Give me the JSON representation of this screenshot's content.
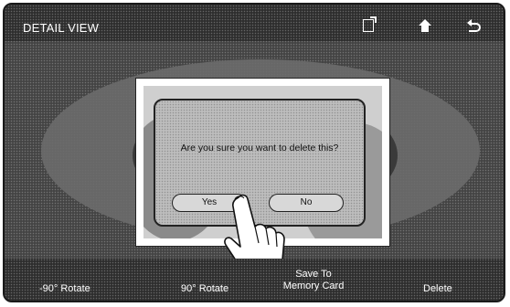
{
  "header": {
    "title": "DETAIL VIEW",
    "icons": [
      "memo-icon",
      "home-icon",
      "back-icon"
    ]
  },
  "dialog": {
    "message": "Are you sure you want to delete this?",
    "yes_label": "Yes",
    "no_label": "No"
  },
  "bottom_bar": {
    "rotate_left": "-90° Rotate",
    "rotate_right": "90° Rotate",
    "save_line1": "Save To",
    "save_line2": "Memory Card",
    "delete": "Delete"
  }
}
